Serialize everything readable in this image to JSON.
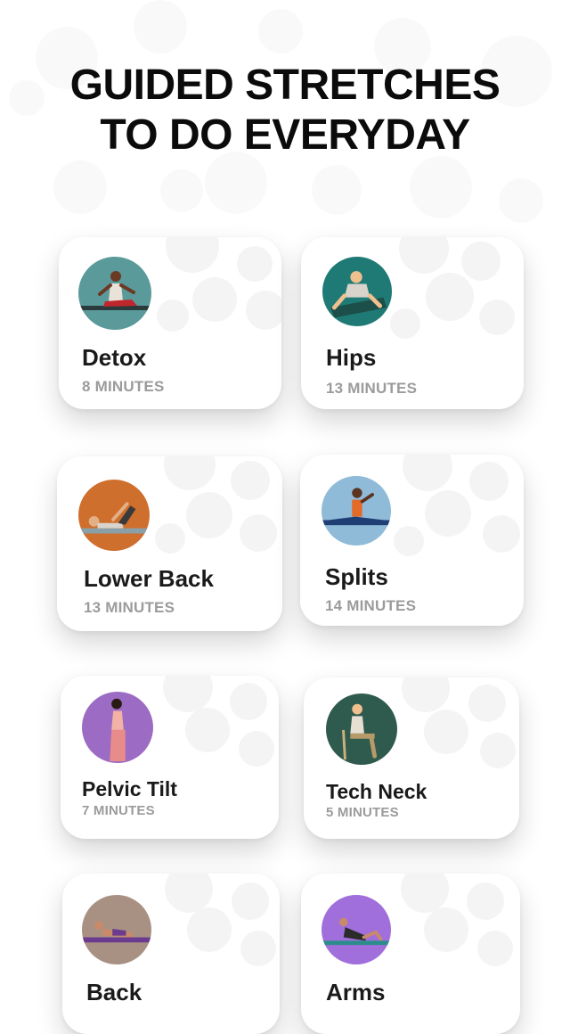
{
  "header": {
    "line1": "GUIDED STRETCHES",
    "line2": "TO DO EVERYDAY"
  },
  "cards": [
    {
      "title": "Detox",
      "duration": "8 MINUTES",
      "avatar_bg": "#5b9a9a",
      "icon": "seated-twist-stretch-icon"
    },
    {
      "title": "Hips",
      "duration": "13 MINUTES",
      "avatar_bg": "#1f7a76",
      "icon": "frog-pose-stretch-icon"
    },
    {
      "title": "Lower Back",
      "duration": "13 MINUTES",
      "avatar_bg": "#cf6f2e",
      "icon": "knee-to-chest-stretch-icon"
    },
    {
      "title": "Splits",
      "duration": "14 MINUTES",
      "avatar_bg": "#8fbbd9",
      "icon": "splits-stretch-icon"
    },
    {
      "title": "Pelvic Tilt",
      "duration": "7 MINUTES",
      "avatar_bg": "#9c6bc3",
      "icon": "standing-pelvic-tilt-icon"
    },
    {
      "title": "Tech Neck",
      "duration": "5 MINUTES",
      "avatar_bg": "#2f5a4e",
      "icon": "seated-phone-posture-icon"
    },
    {
      "title": "Back",
      "duration": "",
      "avatar_bg": "#a89182",
      "icon": "cobra-back-stretch-icon"
    },
    {
      "title": "Arms",
      "duration": "",
      "avatar_bg": "#a06fdc",
      "icon": "seated-arm-stretch-icon"
    }
  ]
}
